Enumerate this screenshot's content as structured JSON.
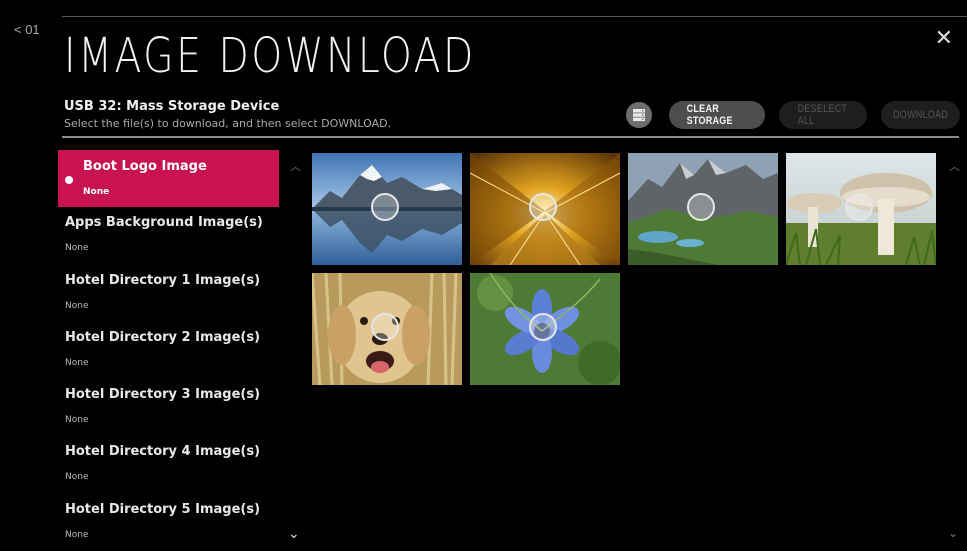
{
  "nav": {
    "back_label": "< 01"
  },
  "header": {
    "title": "IMAGE DOWNLOAD",
    "device": "USB 32: Mass Storage Device",
    "instruction": "Select the file(s) to download, and then select DOWNLOAD.",
    "close_icon": "close-icon"
  },
  "toolbar": {
    "storage_icon": "storage-icon",
    "clear_storage": "CLEAR STORAGE",
    "deselect_all": "DESELECT ALL",
    "download": "DOWNLOAD"
  },
  "sidebar": {
    "items": [
      {
        "label": "Boot Logo Image",
        "value": "None",
        "selected": true
      },
      {
        "label": "Apps Background Image(s)",
        "value": "None"
      },
      {
        "label": "Hotel Directory 1 Image(s)",
        "value": "None"
      },
      {
        "label": "Hotel Directory 2 Image(s)",
        "value": "None"
      },
      {
        "label": "Hotel Directory 3 Image(s)",
        "value": "None"
      },
      {
        "label": "Hotel Directory 4 Image(s)",
        "value": "None"
      },
      {
        "label": "Hotel Directory 5 Image(s)",
        "value": "None"
      }
    ]
  },
  "thumbnails": [
    {
      "subject": "mountain-lake"
    },
    {
      "subject": "golden-tunnel"
    },
    {
      "subject": "alpine-valley"
    },
    {
      "subject": "mushrooms"
    },
    {
      "subject": "golden-retriever"
    },
    {
      "subject": "blue-flower"
    }
  ],
  "colors": {
    "selected_bg": "#c8134f",
    "button_active": "#4d4d4d",
    "button_disabled": "#1e1e1e"
  }
}
